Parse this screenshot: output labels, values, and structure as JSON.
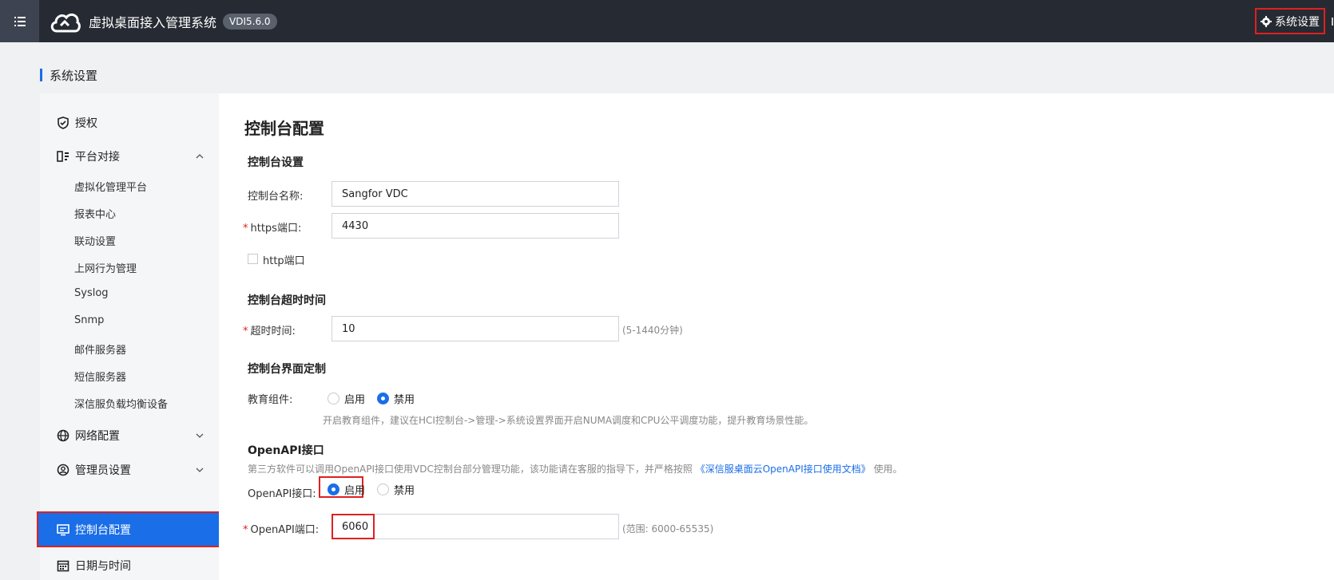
{
  "topbar": {
    "app_title": "虚拟桌面接入管理系统",
    "version": "VDI5.6.0",
    "settings_label": "系统设置"
  },
  "breadcrumb": "系统设置",
  "sidebar": {
    "items": [
      {
        "label": "授权",
        "icon": "shield-check-icon"
      },
      {
        "label": "平台对接",
        "icon": "platform-link-icon",
        "expanded": true,
        "children": [
          "虚拟化管理平台",
          "报表中心",
          "联动设置",
          "上网行为管理",
          "Syslog",
          "Snmp",
          "邮件服务器",
          "短信服务器",
          "深信服负载均衡设备"
        ]
      },
      {
        "label": "网络配置",
        "icon": "globe-icon",
        "expanded": false
      },
      {
        "label": "管理员设置",
        "icon": "user-circle-icon",
        "expanded": false
      },
      {
        "label": "控制台配置",
        "icon": "monitor-icon",
        "active": true
      },
      {
        "label": "日期与时间",
        "icon": "calendar-icon"
      }
    ]
  },
  "main": {
    "title": "控制台配置",
    "console_settings": {
      "heading": "控制台设置",
      "name_label": "控制台名称:",
      "name_value": "Sangfor VDC",
      "https_label": "https端口:",
      "https_value": "4430",
      "http_label": "http端口"
    },
    "timeout": {
      "heading": "控制台超时时间",
      "label": "超时时间:",
      "value": "10",
      "hint": "(5-1440分钟)"
    },
    "custom": {
      "heading": "控制台界面定制",
      "edu_label": "教育组件:",
      "enable": "启用",
      "disable": "禁用",
      "edu_selected": "禁用",
      "hint": "开启教育组件，建议在HCI控制台->管理->系统设置界面开启NUMA调度和CPU公平调度功能，提升教育场景性能。"
    },
    "openapi": {
      "heading": "OpenAPI接口",
      "desc_prefix": "第三方软件可以调用OpenAPI接口使用VDC控制台部分管理功能，该功能请在客服的指导下，并严格按照",
      "desc_link": "《深信服桌面云OpenAPI接口使用文档》",
      "desc_suffix": "使用。",
      "api_label": "OpenAPI接口:",
      "enable": "启用",
      "disable": "禁用",
      "selected": "启用",
      "port_label": "OpenAPI端口:",
      "port_value": "6060",
      "port_hint": "(范围: 6000-65535)"
    }
  },
  "colors": {
    "topbar": "#262b33",
    "accent": "#1a6ee8",
    "highlight_border": "#e02020",
    "required": "#e02020"
  }
}
